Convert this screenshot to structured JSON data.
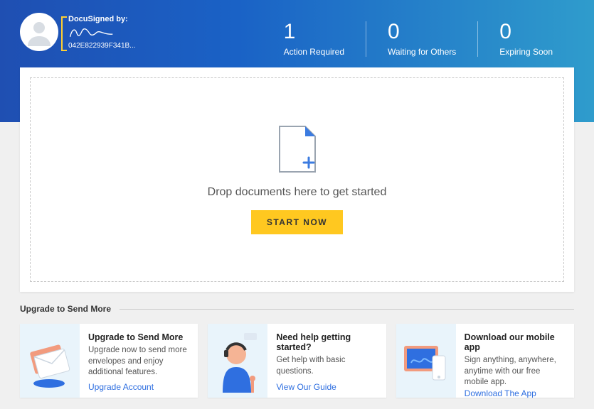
{
  "header": {
    "docusigned_label": "DocuSigned by:",
    "signature_id": "042E822939F341B..."
  },
  "stats": [
    {
      "count": "1",
      "label": "Action Required"
    },
    {
      "count": "0",
      "label": "Waiting for Others"
    },
    {
      "count": "0",
      "label": "Expiring Soon"
    }
  ],
  "dropzone": {
    "text": "Drop documents here to get started",
    "button": "START NOW"
  },
  "section_title": "Upgrade to Send More",
  "cards": [
    {
      "title": "Upgrade to Send More",
      "desc": "Upgrade now to send more envelopes and enjoy additional features.",
      "link": "Upgrade Account"
    },
    {
      "title": "Need help getting started?",
      "desc": "Get help with basic questions.",
      "link": "View Our Guide"
    },
    {
      "title": "Download our mobile app",
      "desc": "Sign anything, anywhere, anytime with our free mobile app.",
      "link": "Download The App"
    }
  ]
}
